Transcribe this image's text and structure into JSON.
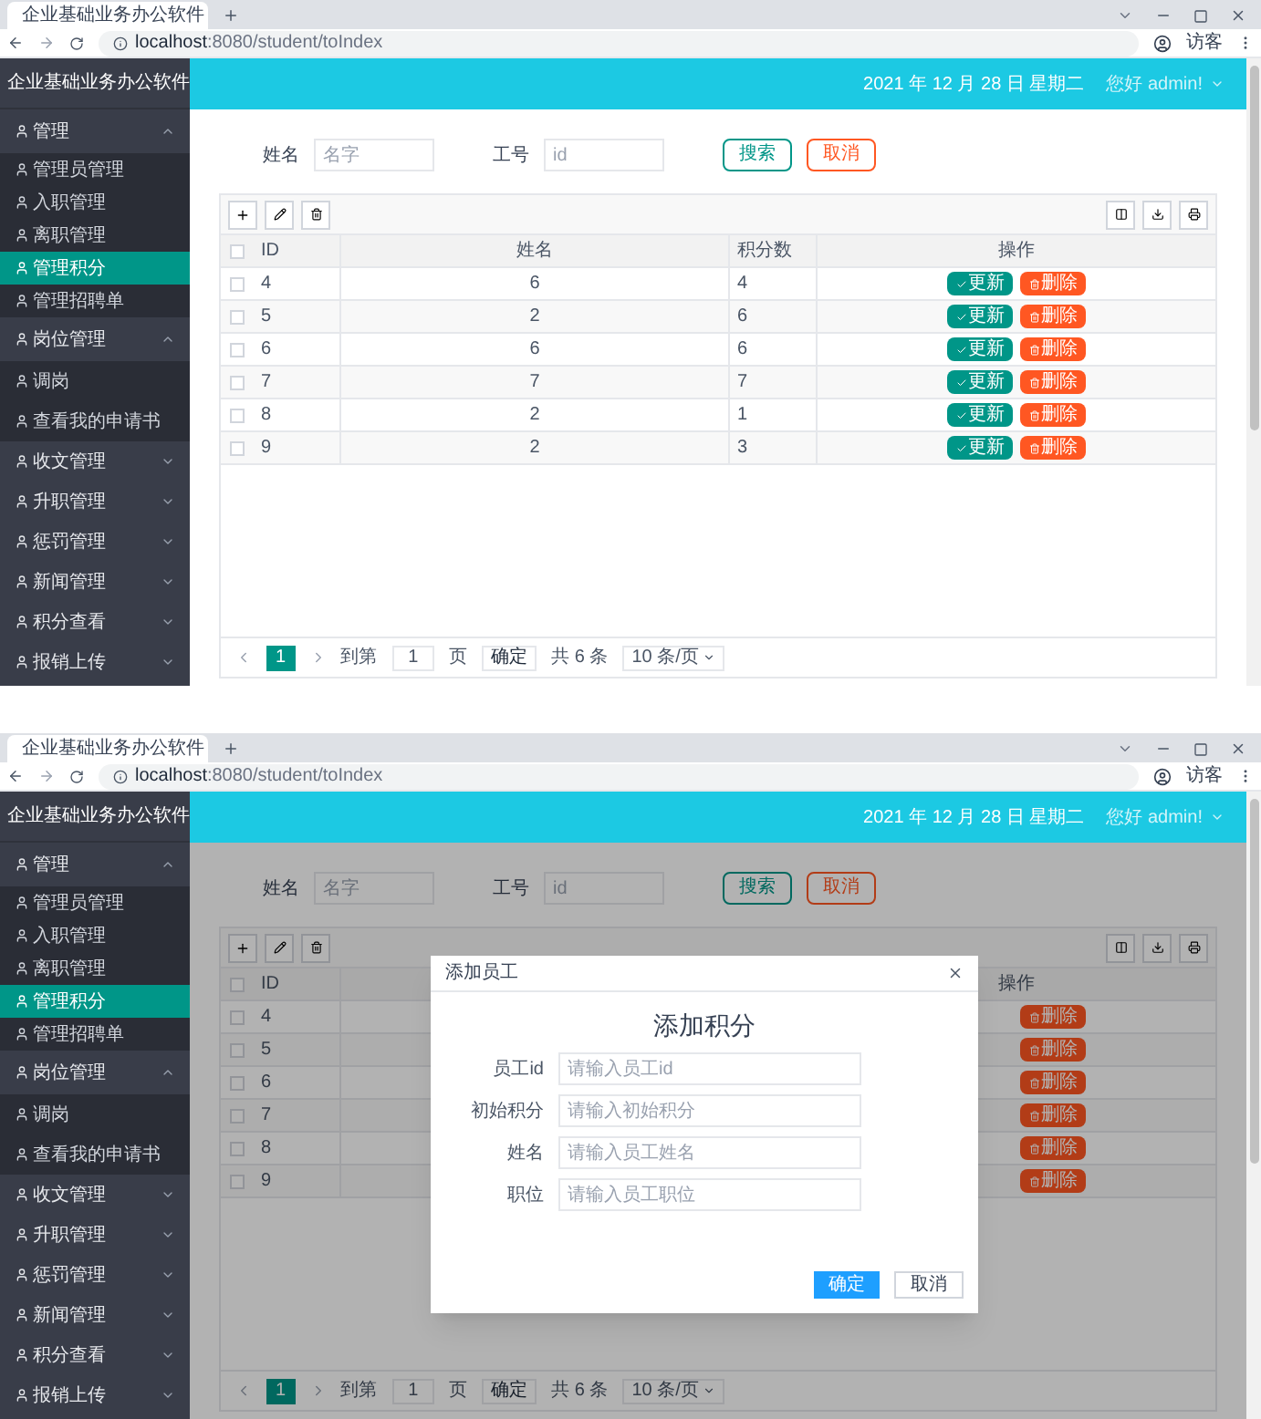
{
  "screens": [
    {
      "browser": {
        "tab_title": "企业基础业务办公软件",
        "url_host": "localhost",
        "url_path": ":8080/student/toIndex",
        "profile": "访客"
      },
      "sidebar": {
        "brand": "企业基础业务办公软件",
        "groups": [
          {
            "label": "管理",
            "expanded": true,
            "children": [
              {
                "label": "管理员管理",
                "selected": false
              },
              {
                "label": "入职管理",
                "selected": false
              },
              {
                "label": "离职管理",
                "selected": false
              },
              {
                "label": "管理积分",
                "selected": true
              },
              {
                "label": "管理招聘单",
                "selected": false
              }
            ]
          },
          {
            "label": "岗位管理",
            "expanded": true,
            "children": [
              {
                "label": "调岗",
                "selected": false
              },
              {
                "label": "查看我的申请书",
                "selected": false
              }
            ]
          },
          {
            "label": "收文管理",
            "expanded": false
          },
          {
            "label": "升职管理",
            "expanded": false
          },
          {
            "label": "惩罚管理",
            "expanded": false
          },
          {
            "label": "新闻管理",
            "expanded": false
          },
          {
            "label": "积分查看",
            "expanded": false
          },
          {
            "label": "报销上传",
            "expanded": false
          }
        ]
      },
      "header": {
        "date": "2021 年 12 月 28 日 星期二",
        "greeting": "您好 admin!"
      },
      "search": {
        "fields": [
          {
            "label": "姓名",
            "placeholder": "名字"
          },
          {
            "label": "工号",
            "placeholder": "id"
          }
        ],
        "buttons": [
          {
            "kind": "search",
            "label": "搜索"
          },
          {
            "kind": "cancel",
            "label": "取消"
          }
        ]
      },
      "table": {
        "select_all": false,
        "columns": {
          "id": "ID",
          "name": "姓名",
          "score": "积分数",
          "actions": "操作"
        },
        "rows": [
          {
            "checked": false,
            "id": "4",
            "name": "6",
            "score": "4",
            "edit": "更新",
            "delete": "删除"
          },
          {
            "checked": false,
            "id": "5",
            "name": "2",
            "score": "6",
            "edit": "更新",
            "delete": "删除"
          },
          {
            "checked": false,
            "id": "6",
            "name": "6",
            "score": "6",
            "edit": "更新",
            "delete": "删除"
          },
          {
            "checked": false,
            "id": "7",
            "name": "7",
            "score": "7",
            "edit": "更新",
            "delete": "删除"
          },
          {
            "checked": false,
            "id": "8",
            "name": "2",
            "score": "1",
            "edit": "更新",
            "delete": "删除"
          },
          {
            "checked": false,
            "id": "9",
            "name": "2",
            "score": "3",
            "edit": "更新",
            "delete": "删除"
          }
        ]
      },
      "pagination": {
        "page": "1",
        "goto": "到第",
        "page_input": "1",
        "page_unit": "页",
        "confirm": "确定",
        "total": "共 6 条",
        "per_page": "10 条/页"
      }
    },
    {
      "browser": {
        "tab_title": "企业基础业务办公软件",
        "url_host": "localhost",
        "url_path": ":8080/student/toIndex",
        "profile": "访客"
      },
      "sidebar": {
        "brand": "企业基础业务办公软件",
        "groups": [
          {
            "label": "管理",
            "expanded": true,
            "children": [
              {
                "label": "管理员管理",
                "selected": false
              },
              {
                "label": "入职管理",
                "selected": false
              },
              {
                "label": "离职管理",
                "selected": false
              },
              {
                "label": "管理积分",
                "selected": true
              },
              {
                "label": "管理招聘单",
                "selected": false
              }
            ]
          },
          {
            "label": "岗位管理",
            "expanded": true,
            "children": [
              {
                "label": "调岗",
                "selected": false
              },
              {
                "label": "查看我的申请书",
                "selected": false
              }
            ]
          },
          {
            "label": "收文管理",
            "expanded": false
          },
          {
            "label": "升职管理",
            "expanded": false
          },
          {
            "label": "惩罚管理",
            "expanded": false
          },
          {
            "label": "新闻管理",
            "expanded": false
          },
          {
            "label": "积分查看",
            "expanded": false
          },
          {
            "label": "报销上传",
            "expanded": false
          }
        ]
      },
      "header": {
        "date": "2021 年 12 月 28 日 星期二",
        "greeting": "您好 admin!"
      },
      "search": {
        "fields": [
          {
            "label": "姓名",
            "placeholder": "名字"
          },
          {
            "label": "工号",
            "placeholder": "id"
          }
        ],
        "buttons": [
          {
            "kind": "search",
            "label": "搜索"
          },
          {
            "kind": "cancel",
            "label": "取消"
          }
        ]
      },
      "table": {
        "select_all": false,
        "columns": {
          "id": "ID",
          "actions": "操作"
        },
        "rows": [
          {
            "checked": false,
            "id": "4",
            "delete": "删除"
          },
          {
            "checked": false,
            "id": "5",
            "delete": "删除"
          },
          {
            "checked": false,
            "id": "6",
            "delete": "删除"
          },
          {
            "checked": false,
            "id": "7",
            "delete": "删除"
          },
          {
            "checked": false,
            "id": "8",
            "delete": "删除"
          },
          {
            "checked": false,
            "id": "9",
            "delete": "删除"
          }
        ]
      },
      "pagination": {
        "page": "1",
        "goto": "到第",
        "page_input": "1",
        "page_unit": "页",
        "confirm": "确定",
        "total": "共 6 条",
        "per_page": "10 条/页"
      },
      "dialog": {
        "title": "添加员工",
        "heading": "添加积分",
        "fields": [
          {
            "label": "员工id",
            "placeholder": "请输入员工id"
          },
          {
            "label": "初始积分",
            "placeholder": "请输入初始积分"
          },
          {
            "label": "姓名",
            "placeholder": "请输入员工姓名"
          },
          {
            "label": "职位",
            "placeholder": "请输入员工职位"
          }
        ],
        "buttons": [
          {
            "kind": "primary",
            "label": "确定"
          },
          {
            "kind": "default",
            "label": "取消"
          }
        ]
      }
    }
  ]
}
